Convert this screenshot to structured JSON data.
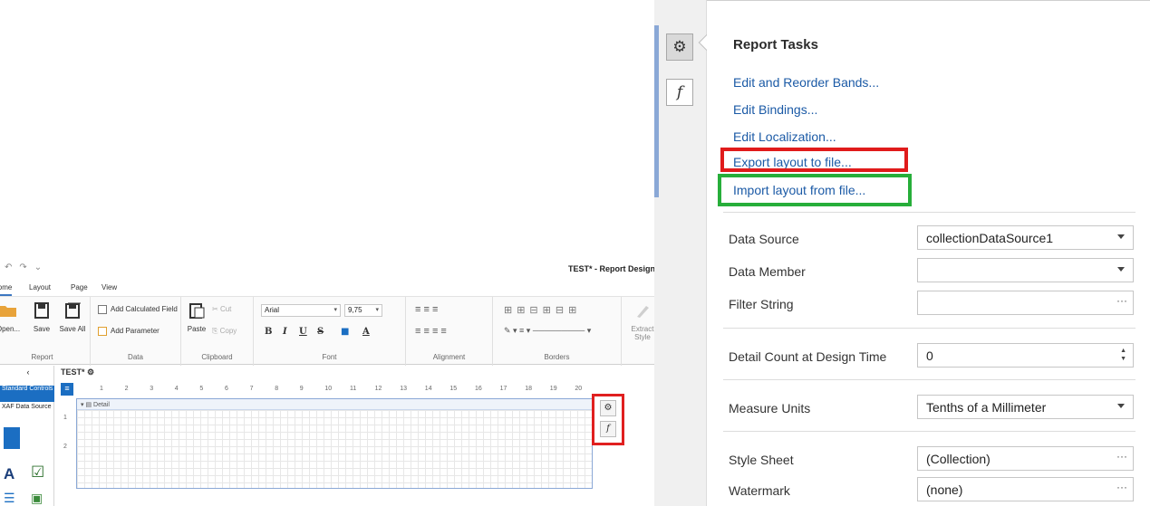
{
  "designer": {
    "title_doc": "TEST*",
    "title_app": " - Report Design",
    "tabs": [
      "Home",
      "Layout",
      "Page",
      "View"
    ],
    "report_group": {
      "open": "Open...",
      "save": "Save",
      "save_all": "Save All",
      "caption": "Report"
    },
    "data_group": {
      "add_calc_field": "Add Calculated Field",
      "add_parameter": "Add Parameter",
      "caption": "Data"
    },
    "clipboard_group": {
      "paste": "Paste",
      "cut": "Cut",
      "copy": "Copy",
      "caption": "Clipboard"
    },
    "font_group": {
      "font_name": "Arial",
      "font_size": "9,75",
      "caption": "Font",
      "bold": "B",
      "italic": "I",
      "underline": "U",
      "strike": "S",
      "color_letter": "A"
    },
    "alignment_group": {
      "caption": "Alignment"
    },
    "borders_group": {
      "caption": "Borders"
    },
    "extract_style": "Extract Style",
    "toolbox": {
      "back": "‹",
      "items": [
        "Standard Controls",
        "XAF Data Source"
      ]
    },
    "doc_tab": "TEST*",
    "ruler_marks": [
      "1",
      "2",
      "3",
      "4",
      "5",
      "6",
      "7",
      "8",
      "9",
      "10",
      "11",
      "12",
      "13",
      "14",
      "15",
      "16",
      "17",
      "18",
      "19",
      "20"
    ],
    "ruler_v": [
      "1",
      "2"
    ],
    "band_label": "Detail"
  },
  "report_tasks": {
    "title": "Report Tasks",
    "links": [
      "Edit and Reorder Bands...",
      "Edit Bindings...",
      "Edit Localization...",
      "Export layout to file...",
      "Import layout from file..."
    ],
    "properties": [
      {
        "label": "Data Source",
        "value": "collectionDataSource1",
        "editor": "dropdown"
      },
      {
        "label": "Data Member",
        "value": "",
        "editor": "dropdown"
      },
      {
        "label": "Filter String",
        "value": "",
        "editor": "ellipsis"
      },
      {
        "label": "Detail Count at Design Time",
        "value": "0",
        "editor": "spin"
      },
      {
        "label": "Measure Units",
        "value": "Tenths of a Millimeter",
        "editor": "dropdown"
      },
      {
        "label": "Style Sheet",
        "value": "(Collection)",
        "editor": "ellipsis"
      },
      {
        "label": "Watermark",
        "value": "(none)",
        "editor": "ellipsis"
      }
    ]
  },
  "icons": {
    "tasks_button": "gear-icon",
    "expression_button": "function-icon"
  },
  "colors": {
    "link": "#1b5aa6",
    "highlight_export": "#e01b1b",
    "highlight_import": "#27ae3a",
    "selection": "#1b6ec2"
  }
}
